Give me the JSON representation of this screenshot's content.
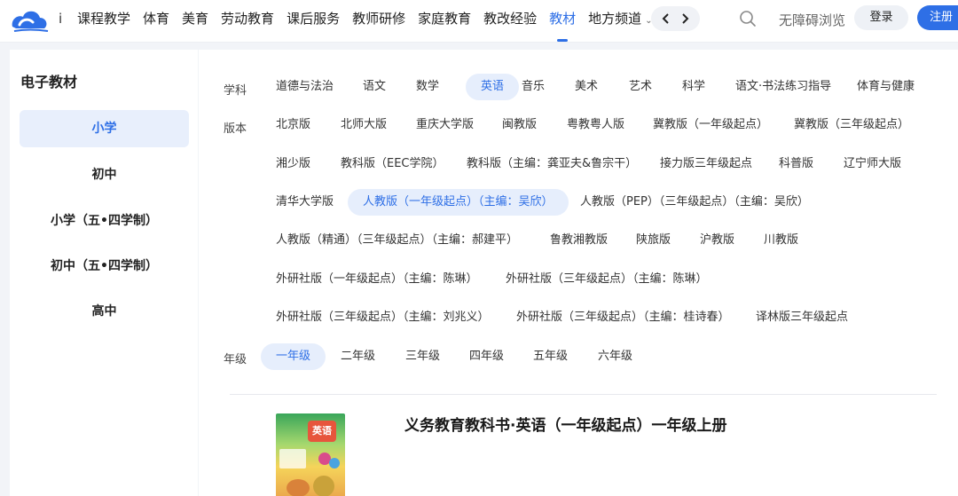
{
  "header": {
    "nav_cut": "i",
    "nav": [
      {
        "label": "课程教学",
        "name": "nav-course-teaching"
      },
      {
        "label": "体育",
        "name": "nav-pe"
      },
      {
        "label": "美育",
        "name": "nav-arts"
      },
      {
        "label": "劳动教育",
        "name": "nav-labor"
      },
      {
        "label": "课后服务",
        "name": "nav-after-school"
      },
      {
        "label": "教师研修",
        "name": "nav-teacher-training"
      },
      {
        "label": "家庭教育",
        "name": "nav-family"
      },
      {
        "label": "教改经验",
        "name": "nav-reform"
      },
      {
        "label": "教材",
        "name": "nav-textbooks",
        "active": true
      },
      {
        "label": "地方频道",
        "name": "nav-local",
        "dropdown": true
      }
    ],
    "a11y_label": "无障碍浏览",
    "login_label": "登录",
    "register_label": "注册",
    "accent_color": "#2e6fe6"
  },
  "sidebar": {
    "title": "电子教材",
    "items": [
      {
        "label": "小学",
        "active": true
      },
      {
        "label": "初中"
      },
      {
        "label": "小学（五•四学制）"
      },
      {
        "label": "初中（五•四学制）"
      },
      {
        "label": "高中"
      }
    ]
  },
  "filters": {
    "subject_label": "学科",
    "subjects": [
      "道德与法治",
      "语文",
      "数学",
      "英语",
      "音乐",
      "美术",
      "艺术",
      "科学",
      "语文·书法练习指导",
      "体育与健康"
    ],
    "subject_active": "英语",
    "edition_label": "版本",
    "editions": [
      "北京版",
      "北师大版",
      "重庆大学版",
      "闽教版",
      "粤教粤人版",
      "冀教版（一年级起点）",
      "冀教版（三年级起点）",
      "湘少版",
      "教科版（EEC学院）",
      "教科版（主编：龚亚夫&鲁宗干）",
      "接力版三年级起点",
      "科普版",
      "辽宁师大版",
      "清华大学版",
      "人教版（一年级起点）（主编：吴欣）",
      "人教版（PEP）（三年级起点）（主编：吴欣）",
      "人教版（精通）（三年级起点）（主编：郝建平）",
      "鲁教湘教版",
      "陕旅版",
      "沪教版",
      "川教版",
      "外研社版（一年级起点）（主编：陈琳）",
      "外研社版（三年级起点）（主编：陈琳）",
      "外研社版（三年级起点）（主编：刘兆义）",
      "外研社版（三年级起点）（主编：桂诗春）",
      "译林版三年级起点"
    ],
    "edition_active": "人教版（一年级起点）（主编：吴欣）",
    "grade_label": "年级",
    "grades": [
      "一年级",
      "二年级",
      "三年级",
      "四年级",
      "五年级",
      "六年级"
    ],
    "grade_active": "一年级"
  },
  "book": {
    "title": "义务教育教科书·英语（一年级起点）一年级上册",
    "cover_text": "英语"
  }
}
